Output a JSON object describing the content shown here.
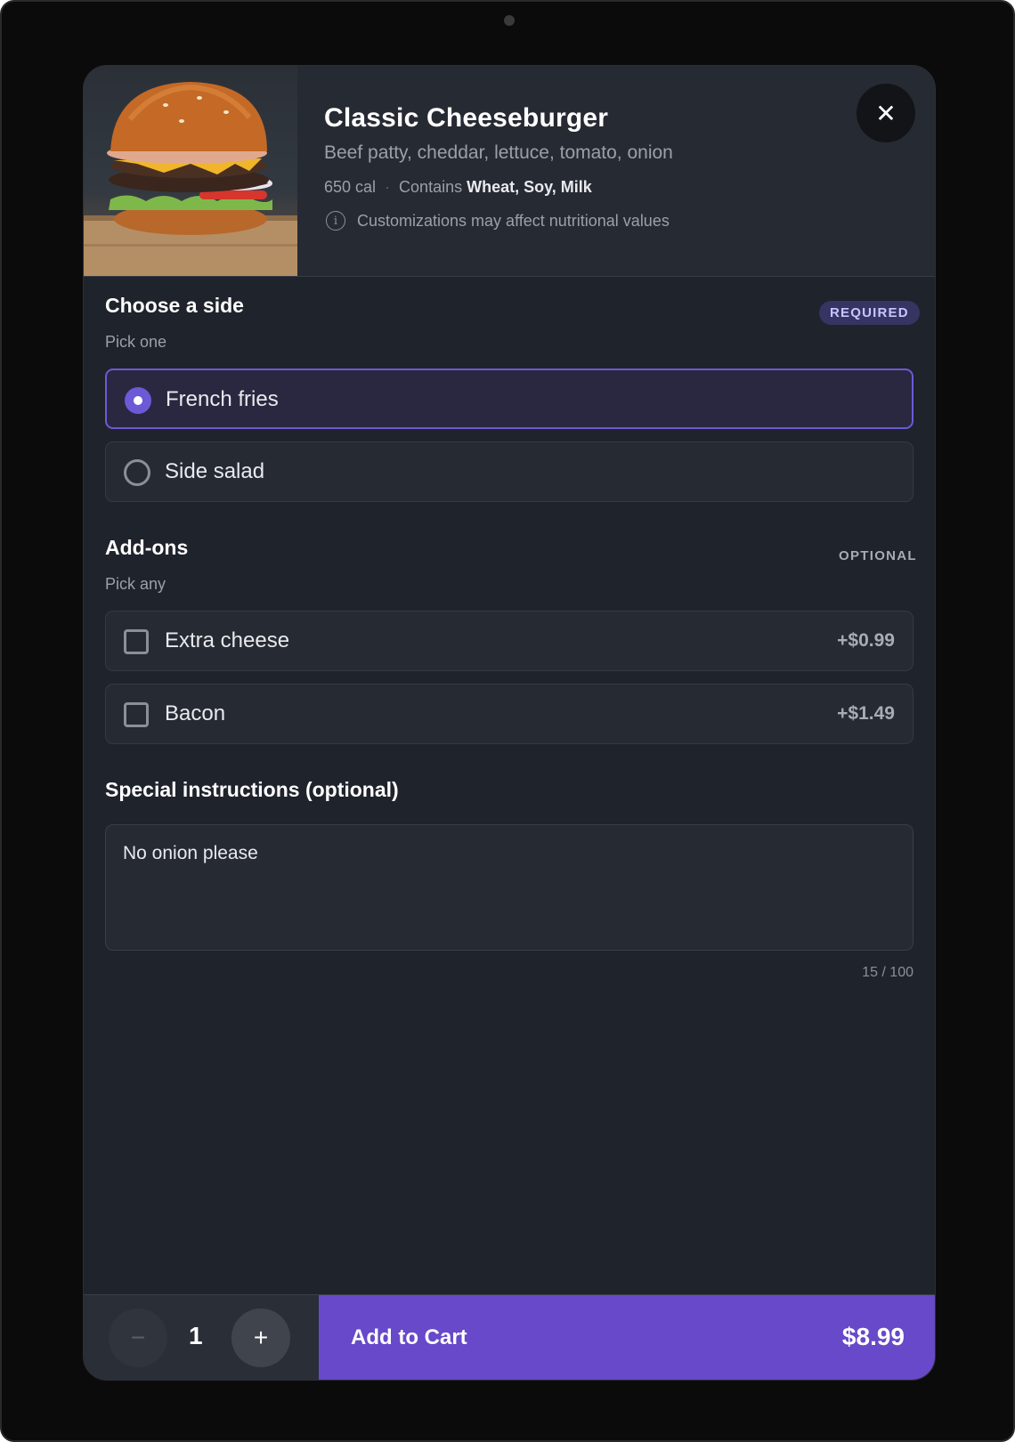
{
  "item": {
    "title": "Classic Cheeseburger",
    "description": "Beef patty, cheddar, lettuce, tomato, onion",
    "calories": "650 cal",
    "separator": "·",
    "contains_label": "Contains",
    "allergens": "Wheat, Soy, Milk",
    "note": "Customizations may affect nutritional values",
    "info_icon": "i",
    "close_icon": "✕"
  },
  "side": {
    "title": "Choose a side",
    "badge": "REQUIRED",
    "hint": "Pick one",
    "options": [
      {
        "label": "French fries",
        "selected": true
      },
      {
        "label": "Side salad",
        "selected": false
      }
    ]
  },
  "addons": {
    "title": "Add-ons",
    "badge": "OPTIONAL",
    "hint": "Pick any",
    "options": [
      {
        "label": "Extra cheese",
        "price": "+$0.99",
        "checked": false
      },
      {
        "label": "Bacon",
        "price": "+$1.49",
        "checked": false
      }
    ]
  },
  "instructions": {
    "title": "Special instructions (optional)",
    "value": "No onion please",
    "counter": "15 / 100"
  },
  "footer": {
    "minus_icon": "−",
    "plus_icon": "+",
    "quantity": "1",
    "add_label": "Add to Cart",
    "total": "$8.99"
  },
  "colors": {
    "accent": "#6749c9",
    "selected_border": "#6b5ad6",
    "background": "#1f232b"
  }
}
